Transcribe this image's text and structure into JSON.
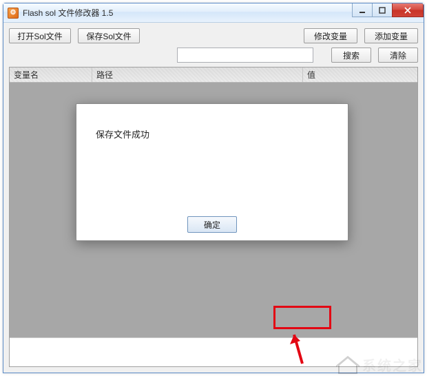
{
  "window": {
    "title": "Flash sol 文件修改器 1.5"
  },
  "toolbar": {
    "open_label": "打开Sol文件",
    "save_label": "保存Sol文件",
    "modify_label": "修改变量",
    "add_label": "添加变量",
    "search_label": "搜索",
    "clear_label": "清除",
    "search_value": ""
  },
  "grid": {
    "columns": {
      "name": "变量名",
      "path": "路径",
      "value": "值"
    },
    "rows": []
  },
  "dialog": {
    "message": "保存文件成功",
    "ok_label": "确定"
  },
  "watermark": {
    "text": "系统之家"
  }
}
